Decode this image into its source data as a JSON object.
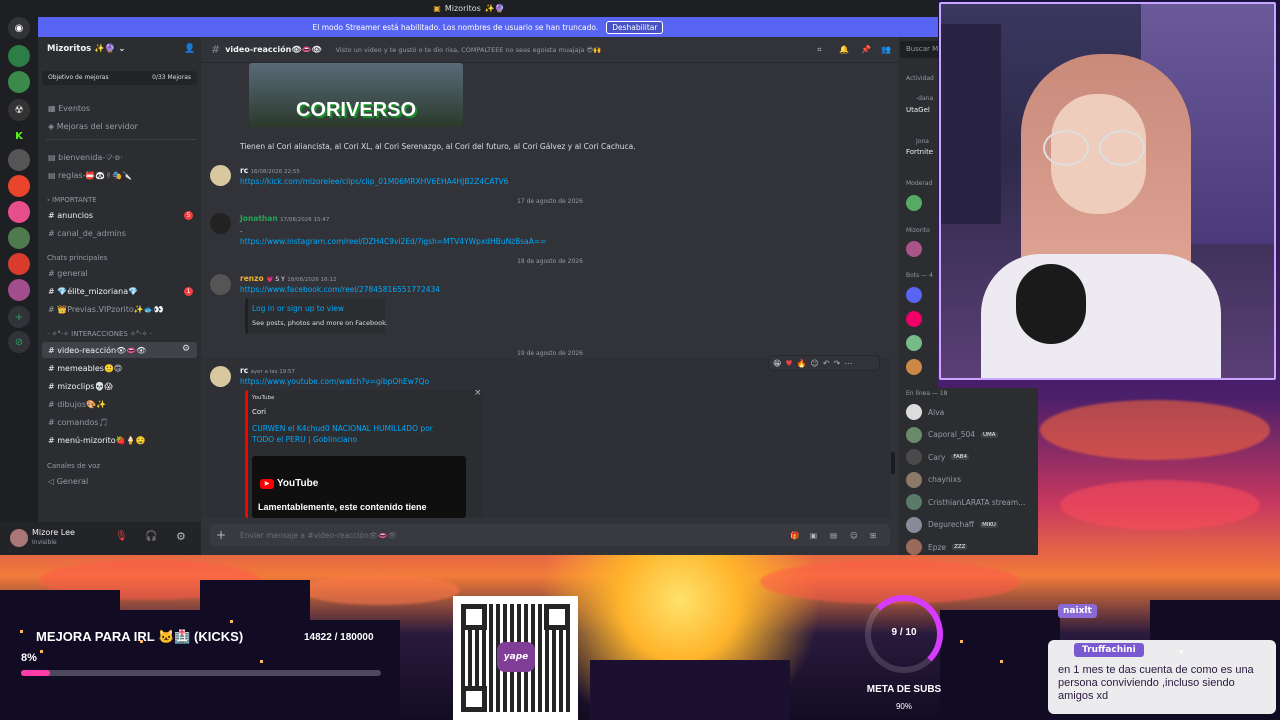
{
  "window": {
    "title": "Mizoritos",
    "title_emoji": "✨🔮"
  },
  "banner": {
    "text": "El modo Streamer está habilitado. Los nombres de usuario se han truncado.",
    "button": "Deshabilitar"
  },
  "server": {
    "name": "Mizoritos",
    "name_emoji": "✨🔮",
    "goal_label": "Objetivo de mejoras",
    "goal_value": "0/33 Mejoras"
  },
  "channels": {
    "events": "Eventos",
    "boosts": "Mejoras del servidor",
    "ch1": "bienvenida-♡̷·ʚ·",
    "ch2": "reglas-📛🐼✌🎭🔪",
    "cat_importante": "IMPORTANTE",
    "anuncios": "anuncios",
    "anuncios_badge": "5",
    "canal_admins": "canal_de_admins",
    "cat_chats": "Chats principales",
    "general": "general",
    "elite": "💎élite_mizoriana💎",
    "elite_badge": "1",
    "previas": "👑Previas.VIPzorito✨🐟👀",
    "cat_inter": "· ✧°·✧ INTERACCIONES ✧°·✧ ·",
    "video": "video-reacción👁👄👁",
    "memeables": "memeables🙂🙃",
    "mizoclips": "mizoclips💀😱",
    "dibujos": "dibujos🎨✨",
    "comandos": "comandos🎵",
    "menu": "menú-mizorito🍓🍦🤤",
    "cat_voz": "Canales de voz",
    "general_voz": "General"
  },
  "user": {
    "name": "Mizore Lee",
    "status": "Invisible"
  },
  "chat": {
    "channel": "video-reacción👁👄👁",
    "topic": "Visto un video y te gustó o te dio risa, COMPALTEEE no seas egoista muajaja 😎🙌",
    "search": "Buscar Mizo",
    "thumb_text": "CORIVERSO",
    "msg0": "Tienen al Cori aliancista, al Cori XL, al Cori Serenazgo, al Cori del futuro, al Cori Gálvez y al Cori Cachuca.",
    "m1_user": "rc",
    "m1_time": "16/08/2026 22:55",
    "m1_link": "https://kick.com/mizorelee/clips/clip_01M06MRXHV6EHA4HJB2Z4CATV6",
    "date1": "17 de agosto de 2026",
    "m2_user": "Jonathan",
    "m2_time": "17/08/2026 15:47",
    "m2_dot": ".",
    "m2_link": "https://www.instagram.com/reel/DZH4C9vi2Ed/?igsh=MTV4YWpxdHBuNzBsaA==",
    "date2": "18 de agosto de 2026",
    "m3_user": "renzo",
    "m3_badge": "💗 S Y",
    "m3_time": "18/08/2026 16:12",
    "m3_link": "https://www.facebook.com/reel/27845816551772434",
    "fb_title": "Log in or sign up to view",
    "fb_desc": "See posts, photos and more on Facebook.",
    "date3": "19 de agosto de 2026",
    "m4_user": "rc",
    "m4_time": "ayer a las 19:57",
    "m4_link": "https://www.youtube.com/watch?v=gibpOhEw7Qo",
    "yt_provider": "YouTube",
    "yt_author": "Cori",
    "yt_title": "CURWEN el K4chud0 NACIONAL HUMILL4DO por TODO el PERU | Goblinciano",
    "yt_logo": "YouTube",
    "yt_unavailable": "Lamentablemente, este contenido tiene",
    "input_placeholder": "Enviar mensaje a #video-reacción👁👄👁"
  },
  "members": {
    "activity_label": "Actividad",
    "act1_user": "-dana",
    "act1_game": "UtaGel",
    "act2_user": "Jona",
    "act2_game": "Fortnite",
    "mod_label": "Moderad",
    "mizo_label": "Mizorito",
    "bots_label": "Bots — 4",
    "online_label": "En línea — 18",
    "list": [
      {
        "name": "Alva",
        "tag": ""
      },
      {
        "name": "Caporal_504",
        "tag": "UMA"
      },
      {
        "name": "Cary",
        "tag": "FAB4"
      },
      {
        "name": "chaynixs",
        "tag": ""
      },
      {
        "name": "CristhianLARATA stream...",
        "tag": ""
      },
      {
        "name": "Degurechaff",
        "tag": "MIKU"
      },
      {
        "name": "Epze",
        "tag": "ZZZ"
      }
    ]
  },
  "overlay": {
    "goal_title": "MEJORA PARA IRL 🐱🏥 (KICKS)",
    "goal_count": "14822 / 180000",
    "goal_percent": "8%",
    "goal_progress": 0.08,
    "qr_label": "yape",
    "subs_count": "9 / 10",
    "subs_label": "META DE SUBS",
    "subs_percent": "90%",
    "subs_progress": 0.9,
    "chat_user1": "naixlt",
    "chat_user2": "Truffachini",
    "chat_msg": "en 1 mes te das cuenta de como es una persona conviviendo ,incluso siendo amigos xd"
  },
  "colors": {
    "accent": "#5865f2",
    "link": "#00a8fc",
    "pink": "#d63cff",
    "green": "#23a55a"
  }
}
